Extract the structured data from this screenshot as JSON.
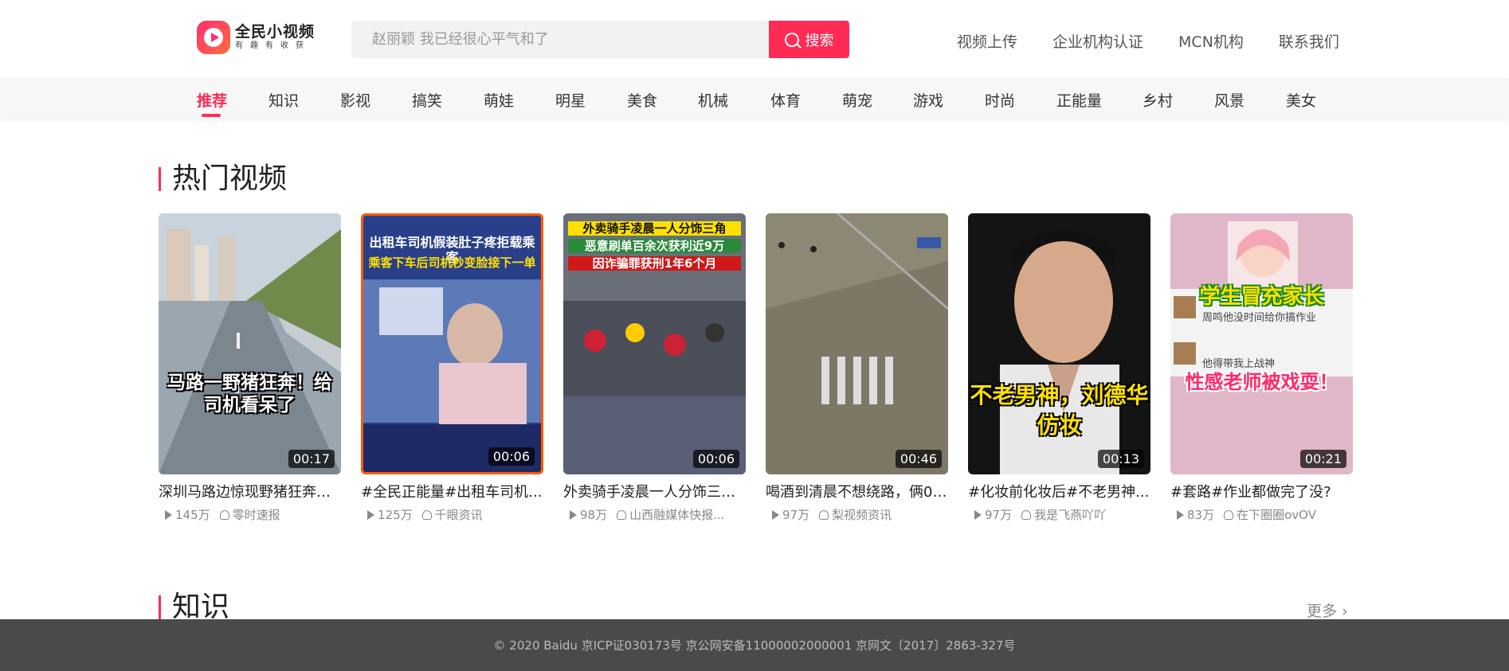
{
  "header": {
    "logo_title": "全民小视频",
    "logo_sub": "有趣有收获",
    "search_placeholder": "赵丽颖 我已经很心平气和了",
    "search_button": "搜索",
    "links": [
      "视频上传",
      "企业机构认证",
      "MCN机构",
      "联系我们"
    ]
  },
  "categories": [
    "推荐",
    "知识",
    "影视",
    "搞笑",
    "萌娃",
    "明星",
    "美食",
    "机械",
    "体育",
    "萌宠",
    "游戏",
    "时尚",
    "正能量",
    "乡村",
    "风景",
    "美女"
  ],
  "active_category": "推荐",
  "sections": {
    "hot_title": "热门视频",
    "knowledge_title": "知识",
    "more": "更多"
  },
  "videos": [
    {
      "title": "深圳马路边惊现野猪狂奔，...",
      "views": "145万",
      "author": "零时速报",
      "duration": "00:17",
      "caption": "马路一野猪狂奔！给司机看呆了"
    },
    {
      "title": "#全民正能量#出租车司机...",
      "views": "125万",
      "author": "千眼资讯",
      "duration": "00:06",
      "caption": "出租车司机假装肚子疼拒载乘客",
      "caption2": "乘客下车后司机秒变脸接下一单"
    },
    {
      "title": "外卖骑手凌晨一人分饰三角...",
      "views": "98万",
      "author": "山西融媒体快报...",
      "duration": "00:06",
      "caption": "外卖骑手凌晨一人分饰三角",
      "caption2": "恶意刷单百余次获利近9万",
      "caption3": "因诈骗罪获刑1年6个月"
    },
    {
      "title": "喝酒到清晨不想绕路，俩00...",
      "views": "97万",
      "author": "梨视频资讯",
      "duration": "00:46"
    },
    {
      "title": "#化妆前化妆后#不老男神...",
      "views": "97万",
      "author": "我是飞燕吖吖",
      "duration": "00:13",
      "caption": "不老男神，刘德华仿妆"
    },
    {
      "title": "#套路#作业都做完了没?",
      "views": "83万",
      "author": "在下圈圈ovOV",
      "duration": "00:21",
      "caption": "学生冒充家长",
      "caption2": "性感老师被戏耍！",
      "chat1": "周鸣他没时间给你搞作业",
      "chat2": "他得带我上战神"
    }
  ],
  "footer": "© 2020 Baidu 京ICP证030173号  京公网安备11000002000001  京网文〔2017〕2863-327号"
}
